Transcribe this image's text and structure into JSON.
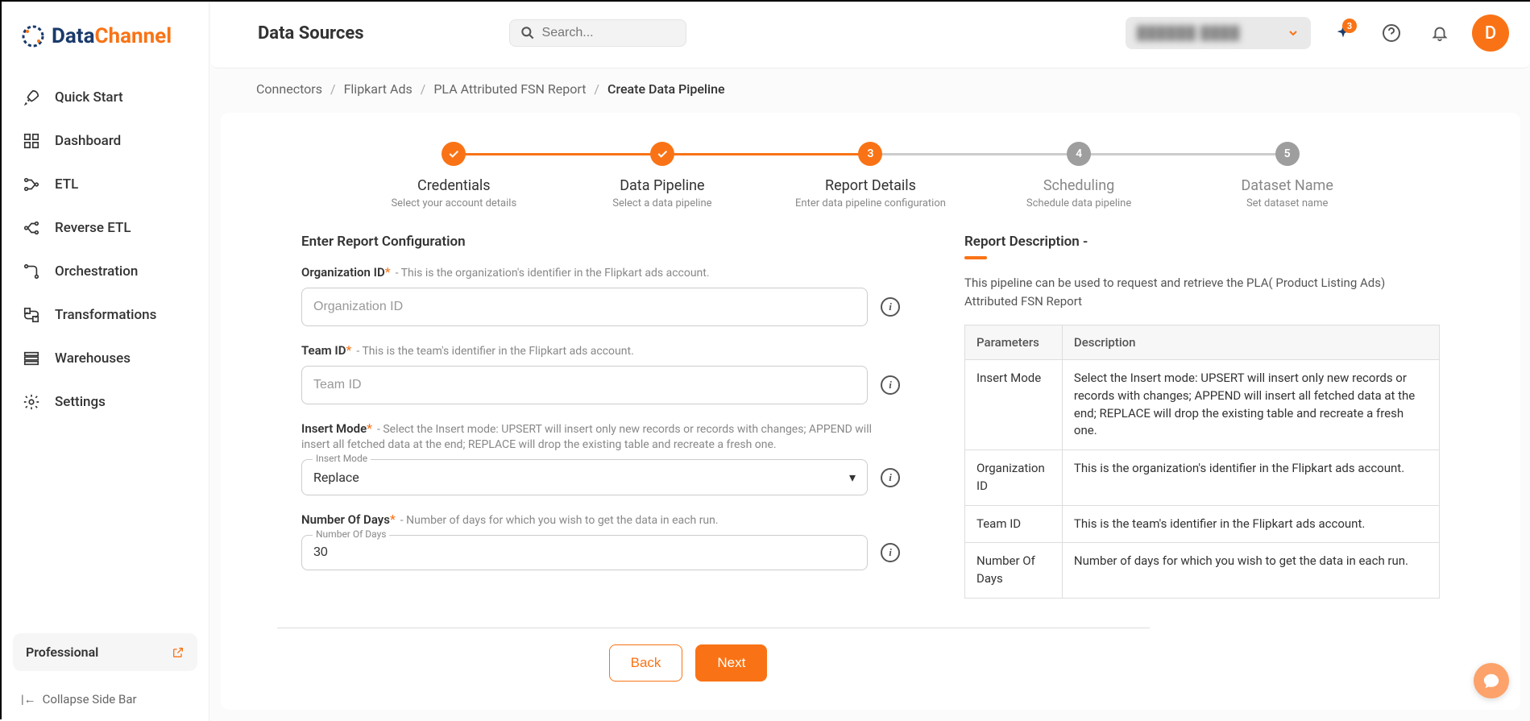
{
  "brand": {
    "part1": "Data",
    "part2": "Channel"
  },
  "sidebar": {
    "items": [
      {
        "label": "Quick Start"
      },
      {
        "label": "Dashboard"
      },
      {
        "label": "ETL"
      },
      {
        "label": "Reverse ETL"
      },
      {
        "label": "Orchestration"
      },
      {
        "label": "Transformations"
      },
      {
        "label": "Warehouses"
      },
      {
        "label": "Settings"
      }
    ],
    "plan_label": "Professional",
    "collapse_label": "Collapse Side Bar"
  },
  "header": {
    "page_title": "Data Sources",
    "search_placeholder": "Search...",
    "workspace_label": "██████ ████",
    "notif_badge": "3",
    "avatar_initial": "D"
  },
  "breadcrumb": {
    "items": [
      "Connectors",
      "Flipkart Ads",
      "PLA Attributed FSN Report",
      "Create Data Pipeline"
    ]
  },
  "stepper": [
    {
      "title": "Credentials",
      "sub": "Select your account details",
      "state": "done",
      "num": ""
    },
    {
      "title": "Data Pipeline",
      "sub": "Select a data pipeline",
      "state": "done",
      "num": ""
    },
    {
      "title": "Report Details",
      "sub": "Enter data pipeline configuration",
      "state": "active",
      "num": "3"
    },
    {
      "title": "Scheduling",
      "sub": "Schedule data pipeline",
      "state": "pending",
      "num": "4"
    },
    {
      "title": "Dataset Name",
      "sub": "Set dataset name",
      "state": "pending",
      "num": "5"
    }
  ],
  "form": {
    "section_title": "Enter Report Configuration",
    "org": {
      "label": "Organization ID",
      "hint": "- This is the organization's identifier in the Flipkart ads account.",
      "placeholder": "Organization ID",
      "value": ""
    },
    "team": {
      "label": "Team ID",
      "hint": "- This is the team's identifier in the Flipkart ads account.",
      "placeholder": "Team ID",
      "value": ""
    },
    "mode": {
      "label": "Insert Mode",
      "hint": "- Select the Insert mode: UPSERT will insert only new records or records with changes; APPEND will insert all fetched data at the end; REPLACE will drop the existing table and recreate a fresh one.",
      "float": "Insert Mode",
      "value": "Replace"
    },
    "days": {
      "label": "Number Of Days",
      "hint": "- Number of days for which you wish to get the data in each run.",
      "float": "Number Of Days",
      "value": "30"
    }
  },
  "desc": {
    "title": "Report Description -",
    "text": "This pipeline can be used to request and retrieve the PLA( Product Listing Ads) Attributed FSN Report",
    "th_param": "Parameters",
    "th_desc": "Description",
    "rows": [
      {
        "p": "Insert Mode",
        "d": "Select the Insert mode: UPSERT will insert only new records or records with changes; APPEND will insert all fetched data at the end; REPLACE will drop the existing table and recreate a fresh one."
      },
      {
        "p": "Organization ID",
        "d": "This is the organization's identifier in the Flipkart ads account."
      },
      {
        "p": "Team ID",
        "d": "This is the team's identifier in the Flipkart ads account."
      },
      {
        "p": "Number Of Days",
        "d": "Number of days for which you wish to get the data in each run."
      }
    ]
  },
  "buttons": {
    "back": "Back",
    "next": "Next"
  }
}
